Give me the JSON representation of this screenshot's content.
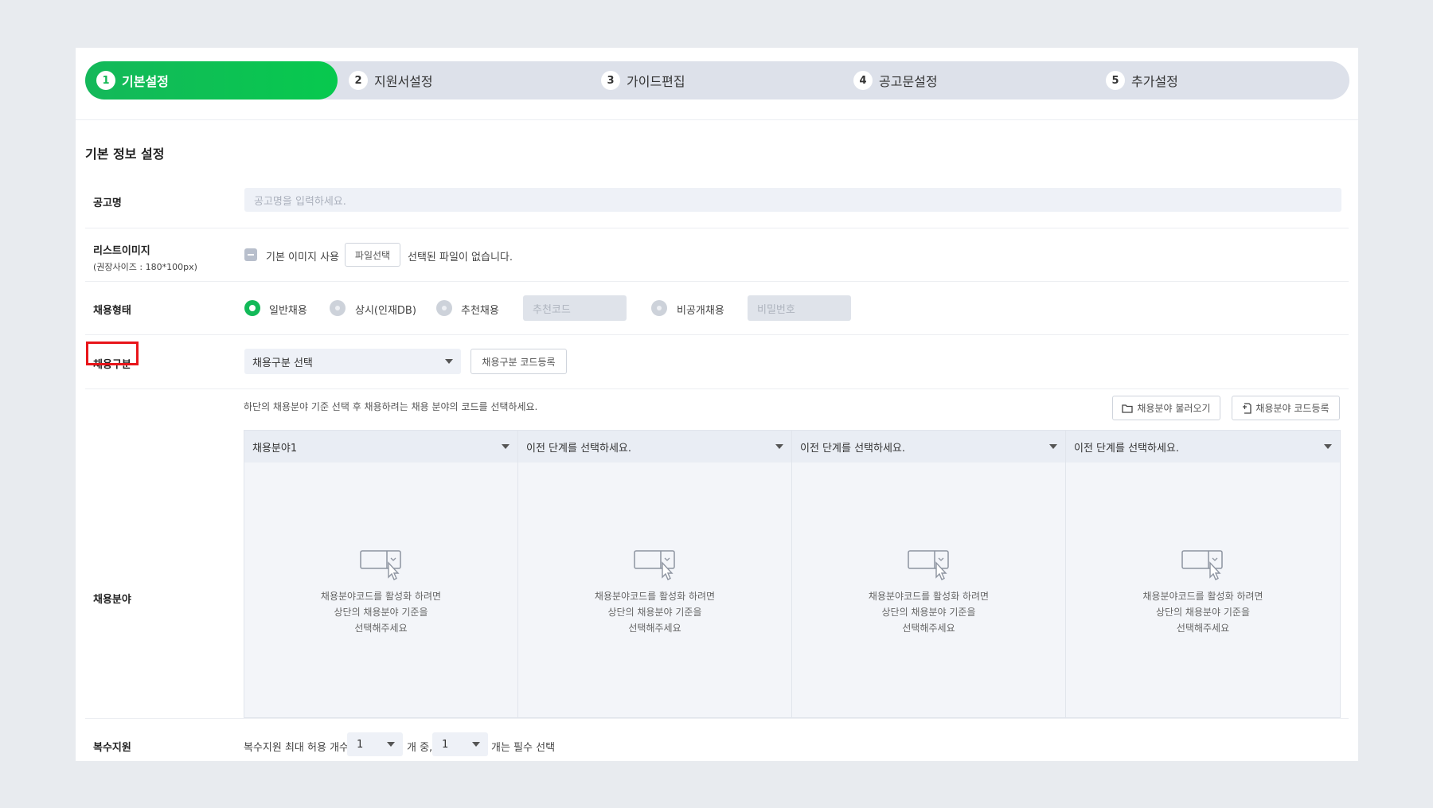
{
  "stepper": {
    "steps": [
      {
        "num": "1",
        "label": "기본설정",
        "active": true
      },
      {
        "num": "2",
        "label": "지원서설정",
        "active": false
      },
      {
        "num": "3",
        "label": "가이드편집",
        "active": false
      },
      {
        "num": "4",
        "label": "공고문설정",
        "active": false
      },
      {
        "num": "5",
        "label": "추가설정",
        "active": false
      }
    ],
    "active_color": "#0fc050"
  },
  "section": {
    "title": "기본 정보 설정"
  },
  "posting_name": {
    "label": "공고명",
    "placeholder": "공고명을 입력하세요."
  },
  "list_image": {
    "label": "리스트이미지",
    "sub_label": "(권장사이즈 : 180*100px)",
    "use_default_label": "기본 이미지 사용",
    "file_button": "파일선택",
    "file_status": "선택된 파일이 없습니다."
  },
  "employment_type": {
    "label": "채용형태",
    "options": [
      {
        "label": "일반채용",
        "selected": true
      },
      {
        "label": "상시(인재DB)",
        "selected": false
      },
      {
        "label": "추천채용",
        "selected": false
      },
      {
        "label": "비공개채용",
        "selected": false
      }
    ],
    "referral_code_placeholder": "추천코드",
    "password_placeholder": "비밀번호"
  },
  "recruit_category": {
    "label": "채용구분",
    "select_value": "채용구분 선택",
    "code_button": "채용구분 코드등록",
    "highlight_color": "#e8151a"
  },
  "recruit_field": {
    "label": "채용분야",
    "hint": "하단의 채용분야 기준 선택 후 채용하려는 채용 분야의 코드를 선택하세요.",
    "load_button": "채용분야 불러오기",
    "code_button": "채용분야 코드등록",
    "columns": [
      {
        "header": "채용분야1"
      },
      {
        "header": "이전 단계를 선택하세요."
      },
      {
        "header": "이전 단계를 선택하세요."
      },
      {
        "header": "이전 단계를 선택하세요."
      }
    ],
    "empty_lines": [
      "채용분야코드를 활성화 하려면",
      "상단의 채용분야 기준을",
      "선택해주세요"
    ]
  },
  "multi_apply": {
    "label": "복수지원",
    "prefix": "복수지원 최대 허용 개수",
    "max_value": "1",
    "middle": "개 중,",
    "required_value": "1",
    "suffix": "개는 필수 선택"
  }
}
